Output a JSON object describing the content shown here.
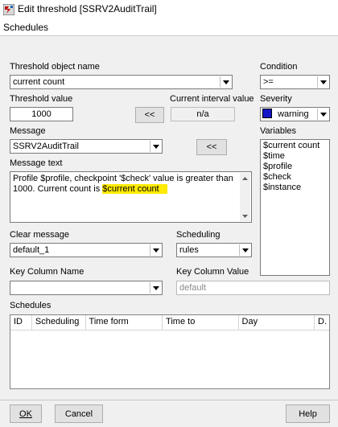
{
  "window": {
    "title": "Edit threshold [SSRV2AuditTrail]"
  },
  "menu": {
    "schedules": "Schedules"
  },
  "threshold": {
    "object_label": "Threshold object name",
    "object_value": "current count",
    "value_label": "Threshold value",
    "value": "1000",
    "current_interval_label": "Current interval value",
    "current_interval_value": "n/a",
    "copy_button": "<<"
  },
  "condition": {
    "label": "Condition",
    "value": ">="
  },
  "severity": {
    "label": "Severity",
    "value": "warning",
    "color": "#1515c8"
  },
  "message": {
    "label": "Message",
    "value": "SSRV2AuditTrail",
    "copy_button": "<<"
  },
  "message_text": {
    "label": "Message text",
    "line1": "Profile $profile, checkpoint '$check' value is greater than",
    "line2_prefix": "1000. Current count is ",
    "line2_highlight": "$current count"
  },
  "variables": {
    "label": "Variables",
    "items": [
      "$current count",
      "$time",
      "$profile",
      "$check",
      "$instance"
    ]
  },
  "clear_message": {
    "label": "Clear message",
    "value": "default_1"
  },
  "scheduling": {
    "label": "Scheduling",
    "value": "rules"
  },
  "key_column": {
    "name_label": "Key Column Name",
    "name_value": "",
    "value_label": "Key Column Value",
    "value_placeholder": "default"
  },
  "schedules": {
    "label": "Schedules",
    "columns": [
      "ID",
      "Scheduling",
      "Time form",
      "Time to",
      "Day",
      "D."
    ]
  },
  "buttons": {
    "ok": "OK",
    "cancel": "Cancel",
    "help": "Help"
  }
}
